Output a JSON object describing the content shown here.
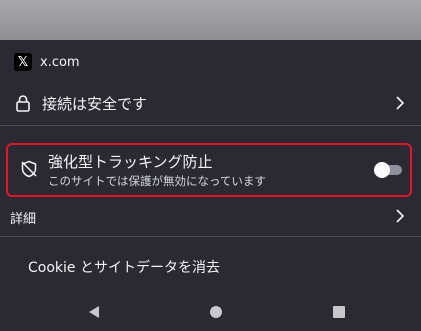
{
  "site": {
    "logo_glyph": "𝕏",
    "name": "x.com"
  },
  "connection": {
    "label": "接続は安全です",
    "icon": "lock-icon"
  },
  "tracking_protection": {
    "title": "強化型トラッキング防止",
    "subtitle": "このサイトでは保護が無効になっています",
    "enabled": false,
    "icon": "shield-off-icon",
    "highlight_color": "#e0162b"
  },
  "details": {
    "label": "詳細"
  },
  "cookies": {
    "label": "Cookie とサイトデータを消去"
  },
  "navbar": {
    "back_icon": "triangle-back-icon",
    "home_icon": "circle-home-icon",
    "recents_icon": "square-recents-icon"
  },
  "colors": {
    "sheet_bg": "#2b2a33",
    "text": "#f3f3f6",
    "divider": "#4a4a52"
  }
}
